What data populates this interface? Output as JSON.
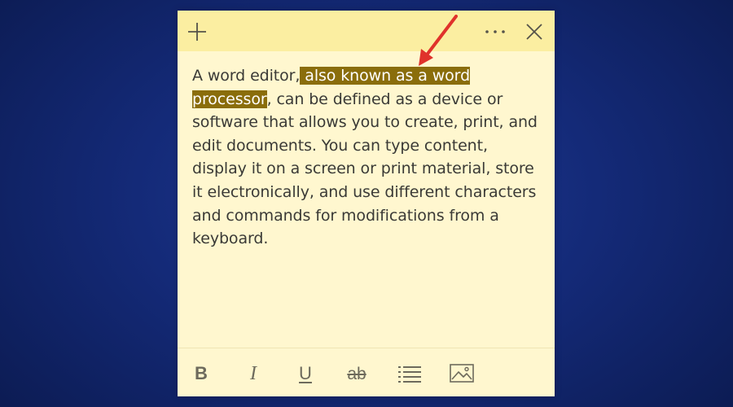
{
  "note": {
    "toolbar": {
      "new_note_icon": "plus-icon",
      "menu_icon": "more-icon",
      "close_icon": "close-icon"
    },
    "content": {
      "before": "A word editor,",
      "highlighted": " also known as a word processor",
      "after": ", can be defined as a device or software that allows you to create, print, and edit documents. You can type content, display it on a screen or print material, store it electronically, and use different characters and commands for modifications from a keyboard."
    },
    "formatting": {
      "bold_label": "B",
      "italic_label": "I",
      "underline_label": "U",
      "strikethrough_label": "ab",
      "list_icon": "bullet-list-icon",
      "image_icon": "image-icon"
    },
    "colors": {
      "titlebar": "#fbeea1",
      "note_background": "#fff7cf",
      "highlight": "#8a6d0b",
      "annotation_arrow": "#e0322b"
    }
  }
}
